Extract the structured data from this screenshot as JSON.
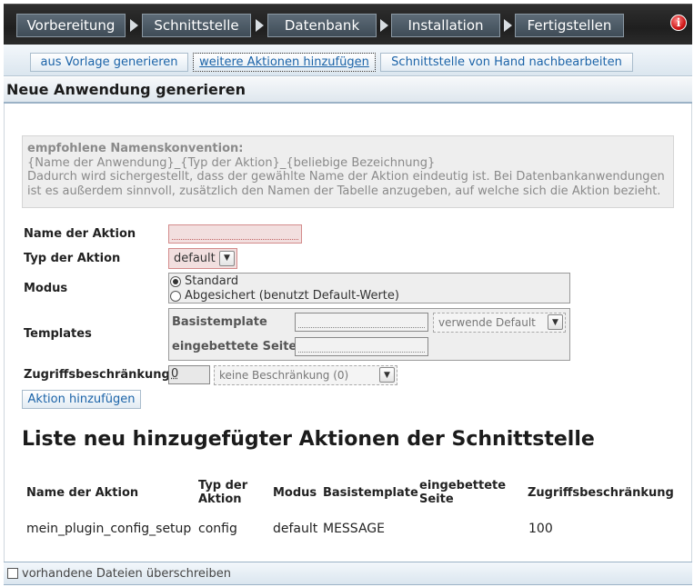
{
  "wizard": {
    "steps": [
      "Vorbereitung",
      "Schnittstelle",
      "Datenbank",
      "Installation",
      "Fertigstellen"
    ],
    "info_icon": "info-icon",
    "info_glyph": "i"
  },
  "subnav": {
    "items": [
      "aus Vorlage generieren",
      "weitere Aktionen hinzufügen",
      "Schnittstelle von Hand nachbearbeiten"
    ],
    "active_index": 1
  },
  "page": {
    "title": "Neue Anwendung generieren"
  },
  "hint": {
    "title": "empfohlene Namenskonvention:",
    "pattern": "{Name der Anwendung}_{Typ der Aktion}_{beliebige Bezeichnung}",
    "line1": "Dadurch wird sichergestellt, dass der gewählte Name der Aktion eindeutig ist. Bei Datenbankanwendungen",
    "line2": "ist es außerdem sinnvoll, zusätzlich den Namen der Tabelle anzugeben, auf welche sich die Aktion bezieht."
  },
  "form": {
    "name_label": "Name der Aktion",
    "name_value": "",
    "type_label": "Typ der Aktion",
    "type_value": "default",
    "mode_label": "Modus",
    "mode_options": [
      "Standard",
      "Abgesichert (benutzt Default-Werte)"
    ],
    "mode_selected": 0,
    "templates_label": "Templates",
    "base_template_label": "Basistemplate",
    "base_template_value": "",
    "base_template_select": "verwende Default",
    "embedded_page_label": "eingebettete Seite",
    "embedded_page_value": "",
    "access_label": "Zugriffsbeschränkung",
    "access_value": "0",
    "access_select": "keine Beschränkung (0)",
    "add_button": "Aktion hinzufügen"
  },
  "list": {
    "title": "Liste neu hinzugefügter Aktionen der Schnittstelle",
    "columns": {
      "name": "Name der Aktion",
      "type_line1": "Typ der",
      "type_line2": "Aktion",
      "mode": "Modus",
      "base": "Basistemplate",
      "embedded_line1": "eingebettete",
      "embedded_line2": "Seite",
      "access": "Zugriffsbeschränkung"
    },
    "rows": [
      {
        "name": "mein_plugin_config_setup",
        "type": "config",
        "mode": "default",
        "base": "MESSAGE",
        "embedded": "",
        "access": "100"
      }
    ]
  },
  "footer": {
    "overwrite_label": "vorhandene Dateien überschreiben",
    "overwrite_checked": false
  }
}
